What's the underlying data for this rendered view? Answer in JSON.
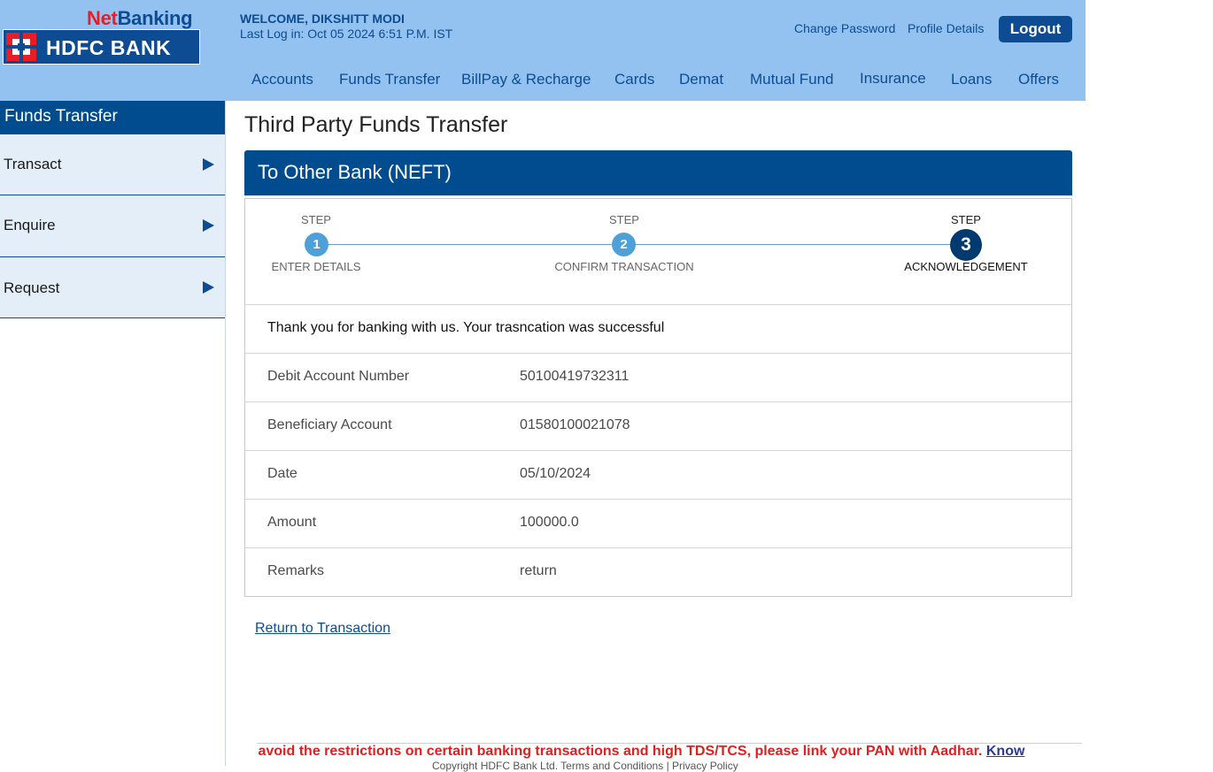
{
  "brand": {
    "netbanking_a": "Net",
    "netbanking_b": "Banking",
    "bank_name": "HDFC BANK"
  },
  "user": {
    "welcome": "WELCOME, DIKSHITT MODI",
    "last_login": "Last Log in: Oct 05 2024 6:51 P.M. IST"
  },
  "top_links": {
    "change_password": "Change Password",
    "profile_details": "Profile Details",
    "logout": "Logout"
  },
  "nav": [
    "Accounts",
    "Funds Transfer",
    "BillPay & Recharge",
    "Cards",
    "Demat",
    "Mutual Fund",
    "Insurance",
    "Loans",
    "Offers"
  ],
  "sidebar": {
    "title": "Funds Transfer",
    "items": [
      {
        "label": "Transact"
      },
      {
        "label": "Enquire"
      },
      {
        "label": "Request"
      }
    ]
  },
  "page": {
    "title": "Third Party Funds Transfer",
    "panel_title": "To Other Bank (NEFT)"
  },
  "steps": [
    {
      "label": "STEP",
      "number": "1",
      "caption": "ENTER DETAILS"
    },
    {
      "label": "STEP",
      "number": "2",
      "caption": "CONFIRM TRANSACTION"
    },
    {
      "label": "STEP",
      "number": "3",
      "caption": "ACKNOWLEDGEMENT"
    }
  ],
  "message": "Thank you for banking with us. Your trasncation was successful",
  "details": [
    {
      "key": "Debit Account Number",
      "value": "50100419732311"
    },
    {
      "key": "Beneficiary Account",
      "value": "01580100021078"
    },
    {
      "key": "Date",
      "value": "05/10/2024"
    },
    {
      "key": "Amount",
      "value": "100000.0"
    },
    {
      "key": "Remarks",
      "value": "return"
    }
  ],
  "return_link": "Return to Transaction",
  "ticker": {
    "text": "Mandatory! To avoid the restrictions on certain banking transactions and high TDS/TCS, please link your PAN with Aadhar.",
    "link": "Know"
  },
  "footer": {
    "copyright": "Copyright HDFC Bank Ltd. Terms and Conditions | Privacy Policy"
  },
  "colors": {
    "header_bg": "#93c2f0",
    "brand_blue": "#004c8f",
    "brand_red": "#ec1c24",
    "ticker_red": "#e0201f",
    "step_blue": "#4ea0d8",
    "step_active": "#003a70"
  }
}
